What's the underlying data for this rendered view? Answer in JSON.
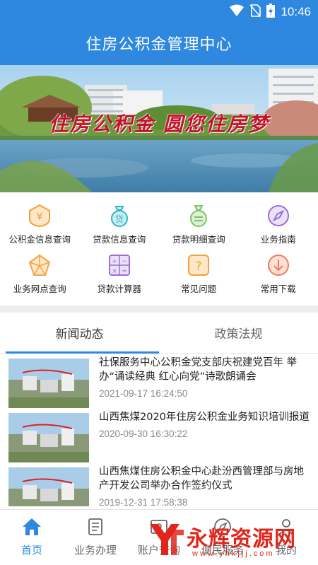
{
  "status_bar": {
    "time": "10:46"
  },
  "app_bar": {
    "title": "住房公积金管理中心"
  },
  "banner": {
    "slogan": "住房公积金 圆您住房梦"
  },
  "services": [
    {
      "label": "公积金信息查询",
      "icon": "yen-shield-icon",
      "color": "#f0a23c"
    },
    {
      "label": "贷款信息查询",
      "icon": "loan-bag-icon",
      "color": "#2fb5c8"
    },
    {
      "label": "贷款明细查询",
      "icon": "money-bag-icon",
      "color": "#7cc36a"
    },
    {
      "label": "业务指南",
      "icon": "compass-icon",
      "color": "#9c6ed8"
    },
    {
      "label": "业务网点查询",
      "icon": "network-icon",
      "color": "#f2a444"
    },
    {
      "label": "贷款计算器",
      "icon": "calculator-icon",
      "color": "#9c6ed8"
    },
    {
      "label": "常见问题",
      "icon": "question-icon",
      "color": "#f0a23c"
    },
    {
      "label": "常用下载",
      "icon": "download-icon",
      "color": "#f07a5a"
    }
  ],
  "tabs": [
    {
      "label": "新闻动态",
      "active": true
    },
    {
      "label": "政策法规",
      "active": false
    }
  ],
  "news": [
    {
      "title": "社保服务中心公积金党支部庆祝建党百年 举办“诵读经典 红心向党”诗歌朗诵会",
      "time": "2021-09-17 16:24:50"
    },
    {
      "title": "山西焦煤2020年住房公积金业务知识培训报道",
      "time": "2020-09-30 16:30:22"
    },
    {
      "title": "山西焦煤住房公积金中心赴汾西管理部与房地产开发公司举办合作签约仪式",
      "time": "2019-12-31 17:58:38"
    }
  ],
  "bottom_nav": [
    {
      "label": "首页",
      "icon": "home-icon",
      "active": true
    },
    {
      "label": "业务办理",
      "icon": "document-icon",
      "active": false
    },
    {
      "label": "账户查询",
      "icon": "account-icon",
      "active": false
    },
    {
      "label": "便民服务",
      "icon": "compass-nav-icon",
      "active": false
    },
    {
      "label": "我的",
      "icon": "user-icon",
      "active": false
    }
  ],
  "watermark": {
    "text": "永辉资源网",
    "url": "www.yhkjjj.com"
  },
  "colors": {
    "primary": "#2e88e0",
    "news_time": "#888888",
    "watermark": "#e0261b"
  }
}
